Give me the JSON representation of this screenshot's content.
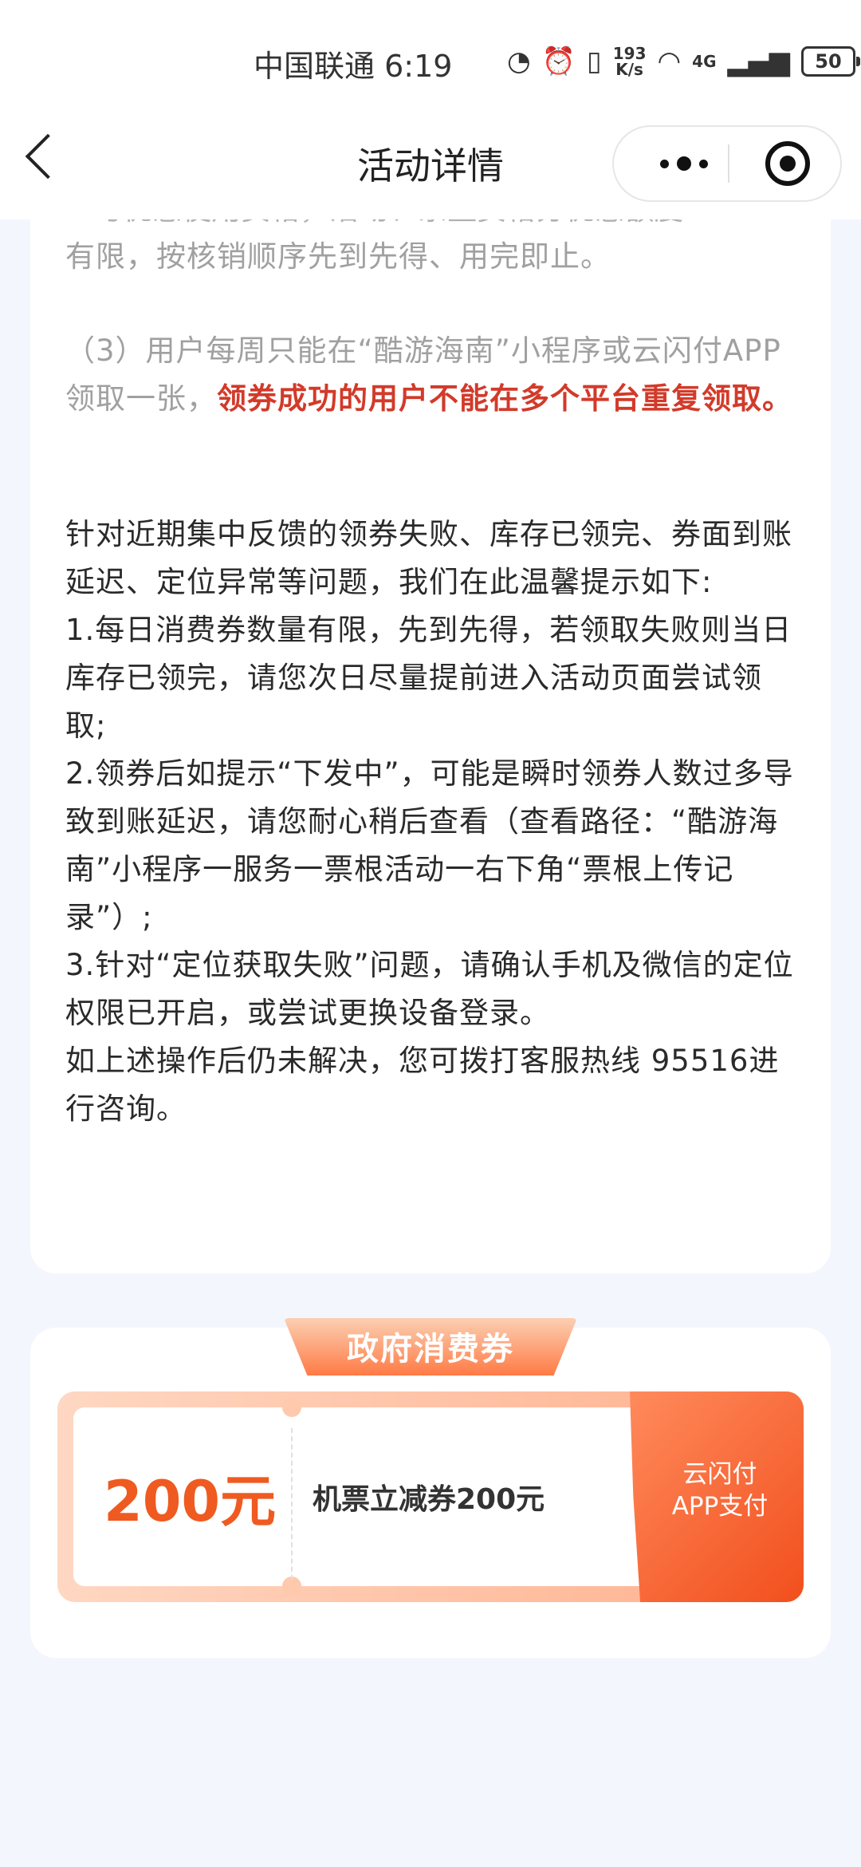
{
  "status_bar": {
    "carrier": "中国联通",
    "time": "6:19",
    "net_speed_value": "193",
    "net_speed_unit": "K/s",
    "network": "4G",
    "battery": "50"
  },
  "nav": {
    "title": "活动详情"
  },
  "content": {
    "cut_line": "...与优惠使用资格，活动、余量资格分优惠额度",
    "p1": "有限，按核销顺序先到先得、用完即止。",
    "p2_gray": "（3）用户每周只能在“酷游海南”小程序或云闪付APP领取一张，",
    "p2_red": "领券成功的用户不能在多个平台重复领取。",
    "p3": [
      "针对近期集中反馈的领券失败、库存已领完、券面到账延迟、定位异常等问题，我们在此温馨提示如下:",
      "1.每日消费券数量有限，先到先得，若领取失败则当日库存已领完，请您次日尽量提前进入活动页面尝试领取;",
      "2.领券后如提示“下发中”，可能是瞬时领券人数过多导致到账延迟，请您耐心稍后查看（查看路径：“酷游海南”小程序一服务一票根活动一右下角“票根上传记录”）;",
      "3.针对“定位获取失败”问题，请确认手机及微信的定位权限已开启，或尝试更换设备登录。",
      "如上述操作后仍未解决，您可拨打客服热线 95516进行咨询。"
    ]
  },
  "coupon": {
    "tag": "政府消费券",
    "amount": "200元",
    "description": "机票立减券200元",
    "pay_line1": "云闪付",
    "pay_line2": "APP支付"
  },
  "colors": {
    "accent_red": "#d23a2a",
    "coupon_orange": "#ef5a21",
    "page_bg": "#f4f6fd"
  }
}
